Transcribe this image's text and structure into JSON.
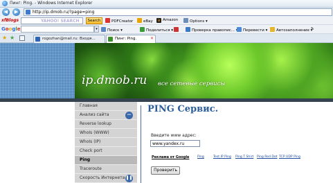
{
  "window": {
    "title": "Пинг: Ping. - Windows Internet Explorer"
  },
  "address_bar": {
    "url": "http://ip.dmob.ru/?page=ping"
  },
  "toolbar1": {
    "logo": "xfBlogs",
    "yahoo_placeholder": "YAHOO! SEARCH",
    "search_label": "Search",
    "items": [
      "PDFCreator",
      "eBay",
      "Amazon",
      "Options"
    ]
  },
  "toolbar2": {
    "items": [
      "Поиск",
      "Поделиться",
      "Проверка правопис...",
      "Перевести",
      "Автозаполнение"
    ]
  },
  "tabs": [
    {
      "label": "rogozhan@mail.ru: Входя..."
    },
    {
      "label": "Пинг: Ping."
    }
  ],
  "site": {
    "title": "ip.dmob.ru",
    "subtitle": "все сетевые сервисы"
  },
  "sidebar": {
    "items": [
      {
        "label": "Главная"
      },
      {
        "label": "Анализ сайта"
      },
      {
        "label": "Reverse lookup"
      },
      {
        "label": "WhoIs (WWW)"
      },
      {
        "label": "WhoIs (IP)"
      },
      {
        "label": "Check port"
      },
      {
        "label": "Ping"
      },
      {
        "label": "Traceroute"
      },
      {
        "label": "Скорость Интернета"
      }
    ]
  },
  "content": {
    "title": "PING Сервис.",
    "address_label": "Введите www адрес:",
    "address_value": "www.yandex.ru",
    "links": [
      "Реклама от Google",
      "Ping",
      "Test IP Ping",
      "Ping T Shirt",
      "Ping Red Dot",
      "TCP UDP Ping"
    ],
    "submit_label": "Проверить"
  }
}
